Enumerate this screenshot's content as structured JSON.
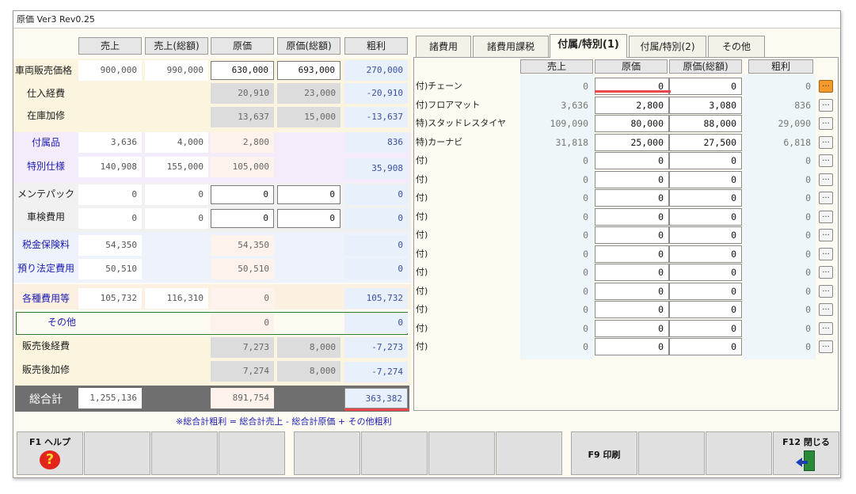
{
  "window": {
    "title": "原価 Ver3 Rev0.25"
  },
  "left": {
    "headers": [
      "売上",
      "売上(総額)",
      "原価",
      "原価(総額)",
      "粗利"
    ],
    "rows": [
      {
        "label": "車両販売価格",
        "v": [
          "900,000",
          "990,000",
          "630,000",
          "693,000",
          "270,000"
        ]
      },
      {
        "label": "仕入経費",
        "v": [
          "",
          "",
          "20,910",
          "23,000",
          "-20,910"
        ]
      },
      {
        "label": "在庫加修",
        "v": [
          "",
          "",
          "13,637",
          "15,000",
          "-13,637"
        ]
      },
      {
        "label": "付属品",
        "v": [
          "3,636",
          "4,000",
          "2,800",
          "",
          "836"
        ]
      },
      {
        "label": "特別仕様",
        "v": [
          "140,908",
          "155,000",
          "105,000",
          "",
          "35,908"
        ]
      },
      {
        "label": "メンテパック",
        "v": [
          "0",
          "0",
          "0",
          "0",
          "0"
        ]
      },
      {
        "label": "車検費用",
        "v": [
          "0",
          "0",
          "0",
          "0",
          "0"
        ]
      },
      {
        "label": "税金保険料",
        "v": [
          "54,350",
          "",
          "54,350",
          "",
          "0"
        ]
      },
      {
        "label": "預り法定費用",
        "v": [
          "50,510",
          "",
          "50,510",
          "",
          "0"
        ]
      },
      {
        "label": "各種費用等",
        "v": [
          "105,732",
          "116,310",
          "0",
          "",
          "105,732"
        ]
      },
      {
        "label": "その他",
        "v": [
          "",
          "",
          "0",
          "",
          "0"
        ]
      },
      {
        "label": "販売後経費",
        "v": [
          "",
          "",
          "7,273",
          "8,000",
          "-7,273"
        ]
      },
      {
        "label": "販売後加修",
        "v": [
          "",
          "",
          "7,274",
          "8,000",
          "-7,274"
        ]
      }
    ],
    "total": {
      "label": "総合計",
      "sales": "1,255,136",
      "cost": "891,754",
      "profit": "363,382"
    },
    "footnote": "※総合計粗利 = 総合計売上 - 総合計原価 + その他粗利"
  },
  "tabs": [
    "諸費用",
    "諸費用課税",
    "付属/特別(1)",
    "付属/特別(2)",
    "その他"
  ],
  "right": {
    "headers": [
      "売上",
      "原価",
      "原価(総額)",
      "粗利"
    ],
    "rows": [
      {
        "label": "付)チェーン",
        "v": [
          "0",
          "0",
          "0",
          "0"
        ]
      },
      {
        "label": "付)フロアマット",
        "v": [
          "3,636",
          "2,800",
          "3,080",
          "836"
        ]
      },
      {
        "label": "特)スタッドレスタイヤ",
        "v": [
          "109,090",
          "80,000",
          "88,000",
          "29,090"
        ]
      },
      {
        "label": "特)カーナビ",
        "v": [
          "31,818",
          "25,000",
          "27,500",
          "6,818"
        ]
      },
      {
        "label": "付)",
        "v": [
          "0",
          "0",
          "0",
          "0"
        ]
      },
      {
        "label": "付)",
        "v": [
          "0",
          "0",
          "0",
          "0"
        ]
      },
      {
        "label": "付)",
        "v": [
          "0",
          "0",
          "0",
          "0"
        ]
      },
      {
        "label": "付)",
        "v": [
          "0",
          "0",
          "0",
          "0"
        ]
      },
      {
        "label": "付)",
        "v": [
          "0",
          "0",
          "0",
          "0"
        ]
      },
      {
        "label": "付)",
        "v": [
          "0",
          "0",
          "0",
          "0"
        ]
      },
      {
        "label": "付)",
        "v": [
          "0",
          "0",
          "0",
          "0"
        ]
      },
      {
        "label": "付)",
        "v": [
          "0",
          "0",
          "0",
          "0"
        ]
      },
      {
        "label": "付)",
        "v": [
          "0",
          "0",
          "0",
          "0"
        ]
      },
      {
        "label": "付)",
        "v": [
          "0",
          "0",
          "0",
          "0"
        ]
      },
      {
        "label": "付)",
        "v": [
          "0",
          "0",
          "0",
          "0"
        ]
      }
    ],
    "dots": "..."
  },
  "fkeys": {
    "f1": "F1 ヘルプ",
    "f9": "F9 印刷",
    "f12": "F12 閉じる"
  },
  "colors": {
    "accent_red": "#e8474c",
    "label_blue": "#1c1cb4",
    "orange_button": "#f39a2c"
  }
}
